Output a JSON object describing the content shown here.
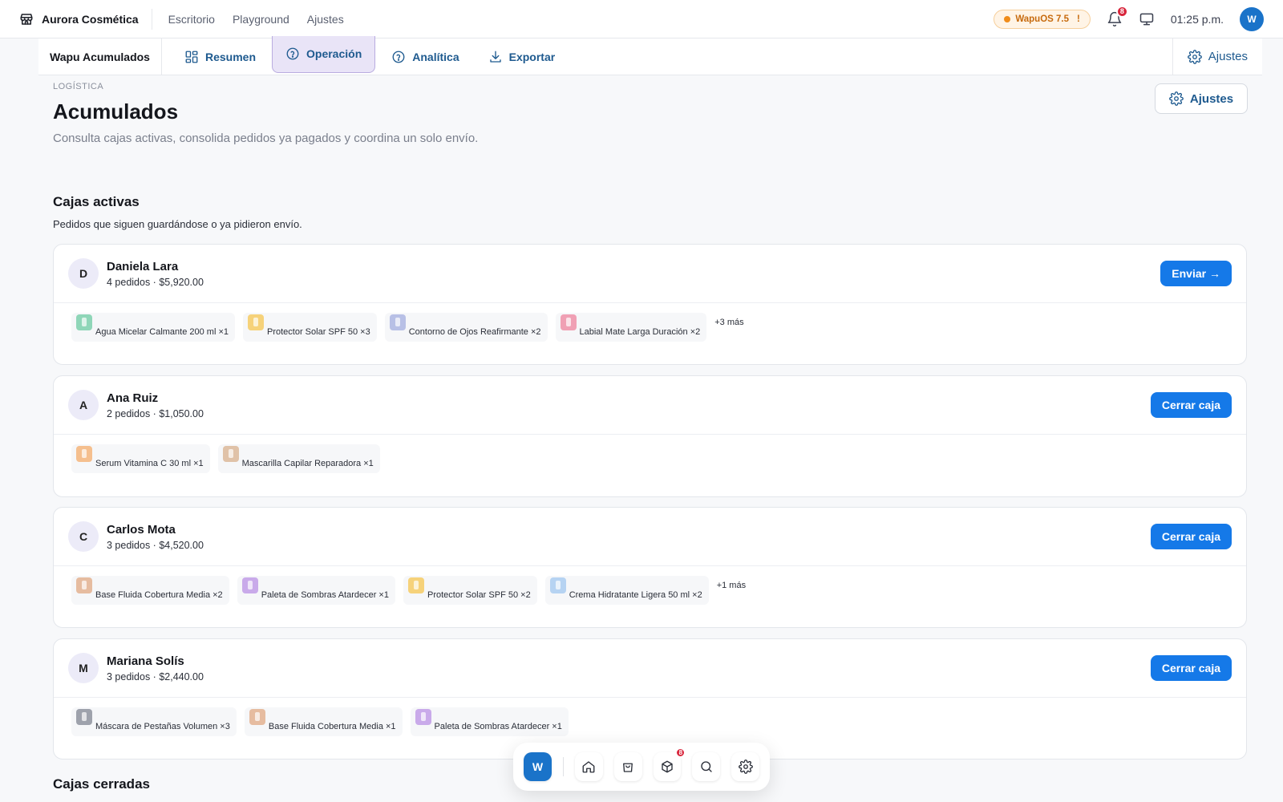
{
  "topbar": {
    "brand": "Aurora Cosmética",
    "nav": [
      "Escritorio",
      "Playground",
      "Ajustes"
    ],
    "os_badge": "WapuOS 7.5",
    "os_alert": "!",
    "notif_count": "8",
    "time": "01:25 p.m.",
    "avatar": "W"
  },
  "subbar": {
    "title": "Wapu Acumulados",
    "tabs": [
      {
        "label": "Resumen",
        "icon": "grid-icon"
      },
      {
        "label": "Operación",
        "icon": "help-circle-icon",
        "active": true
      },
      {
        "label": "Analítica",
        "icon": "help-circle-icon"
      },
      {
        "label": "Exportar",
        "icon": "download-icon"
      }
    ],
    "settings": "Ajustes"
  },
  "page": {
    "eyebrow": "LOGÍSTICA",
    "title": "Acumulados",
    "description": "Consulta cajas activas, consolida pedidos ya pagados y coordina un solo envío.",
    "settings_button": "Ajustes"
  },
  "active_section": {
    "title": "Cajas activas",
    "subtitle": "Pedidos que siguen guardándose o ya pidieron envío."
  },
  "boxes": [
    {
      "initial": "D",
      "name": "Daniela Lara",
      "meta": "4 pedidos · $5,920.00",
      "action": "Enviar →",
      "items": [
        {
          "label": "Agua Micelar Calmante 200 ml ×1",
          "color": "#8fd6b8"
        },
        {
          "label": "Protector Solar SPF 50 ×3",
          "color": "#f6d27a"
        },
        {
          "label": "Contorno de Ojos Reafirmante ×2",
          "color": "#b8c0e6"
        },
        {
          "label": "Labial Mate Larga Duración ×2",
          "color": "#f0a0b4"
        }
      ],
      "more": "+3 más"
    },
    {
      "initial": "A",
      "name": "Ana Ruiz",
      "meta": "2 pedidos · $1,050.00",
      "action": "Cerrar caja",
      "items": [
        {
          "label": "Serum Vitamina C 30 ml ×1",
          "color": "#f5bf8e"
        },
        {
          "label": "Mascarilla Capilar Reparadora ×1",
          "color": "#e0c2a8"
        }
      ],
      "more": ""
    },
    {
      "initial": "C",
      "name": "Carlos Mota",
      "meta": "3 pedidos · $4,520.00",
      "action": "Cerrar caja",
      "items": [
        {
          "label": "Base Fluida Cobertura Media ×2",
          "color": "#e6bca0"
        },
        {
          "label": "Paleta de Sombras Atardecer ×1",
          "color": "#c9aaea"
        },
        {
          "label": "Protector Solar SPF 50 ×2",
          "color": "#f6d27a"
        },
        {
          "label": "Crema Hidratante Ligera 50 ml ×2",
          "color": "#b6d3f2"
        }
      ],
      "more": "+1 más"
    },
    {
      "initial": "M",
      "name": "Mariana Solís",
      "meta": "3 pedidos · $2,440.00",
      "action": "Cerrar caja",
      "items": [
        {
          "label": "Máscara de Pestañas Volumen ×3",
          "color": "#9ea2ac"
        },
        {
          "label": "Base Fluida Cobertura Media ×1",
          "color": "#e6bca0"
        },
        {
          "label": "Paleta de Sombras Atardecer ×1",
          "color": "#c9aaea"
        }
      ],
      "more": ""
    }
  ],
  "closed_section": {
    "title": "Cajas cerradas"
  },
  "dock": {
    "avatar": "W",
    "items": [
      "home-icon",
      "bag-icon",
      "box-icon",
      "search-icon",
      "gear-icon"
    ],
    "box_badge": "8"
  }
}
